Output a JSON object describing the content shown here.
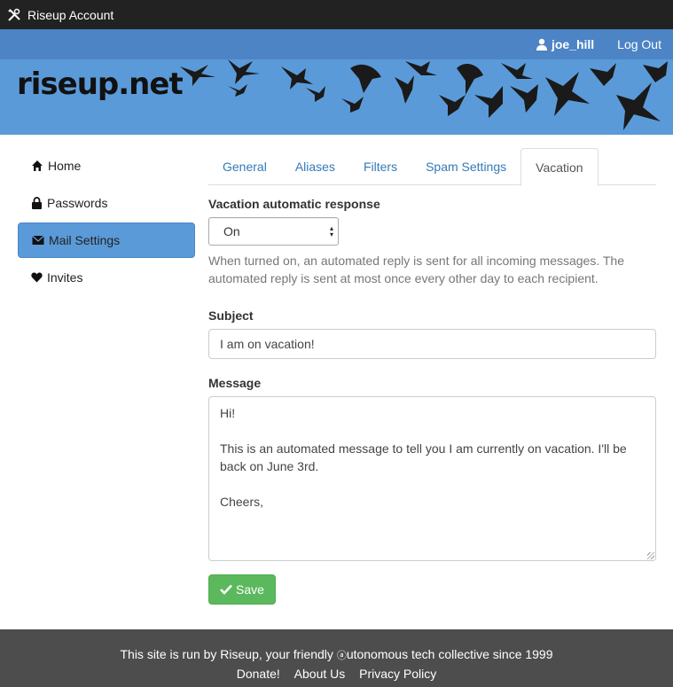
{
  "window": {
    "title": "Riseup Account",
    "icon": "tools-icon"
  },
  "topnav": {
    "username": "joe_hill",
    "logout": "Log Out"
  },
  "banner": {
    "logo": "riseup.net"
  },
  "sidebar": {
    "items": [
      {
        "label": "Home",
        "icon": "home-icon",
        "active": false
      },
      {
        "label": "Passwords",
        "icon": "lock-icon",
        "active": false
      },
      {
        "label": "Mail Settings",
        "icon": "envelope-icon",
        "active": true
      },
      {
        "label": "Invites",
        "icon": "heart-icon",
        "active": false
      }
    ]
  },
  "tabs": [
    {
      "label": "General",
      "active": false
    },
    {
      "label": "Aliases",
      "active": false
    },
    {
      "label": "Filters",
      "active": false
    },
    {
      "label": "Spam Settings",
      "active": false
    },
    {
      "label": "Vacation",
      "active": true
    }
  ],
  "form": {
    "vacation_label": "Vacation automatic response",
    "vacation_value": "On",
    "vacation_help": "When turned on, an automated reply is sent for all incoming messages. The automated reply is sent at most once every other day to each recipient.",
    "subject_label": "Subject",
    "subject_value": "I am on vacation!",
    "message_label": "Message",
    "message_value": "Hi!\n\nThis is an automated message to tell you I am currently on vacation. I'll be back on June 3rd.\n\nCheers,",
    "save_label": "Save"
  },
  "footer": {
    "text_before": "This site is run by Riseup, your friendly ",
    "text_glyph": "ⓐ",
    "text_after": "utonomous tech collective since 1999",
    "links": [
      "Donate!",
      "About Us",
      "Privacy Policy"
    ]
  },
  "colors": {
    "nav": "#4c84c6",
    "banner": "#5b9ad9",
    "save": "#5cb85c",
    "footer": "#4d4d4d"
  }
}
